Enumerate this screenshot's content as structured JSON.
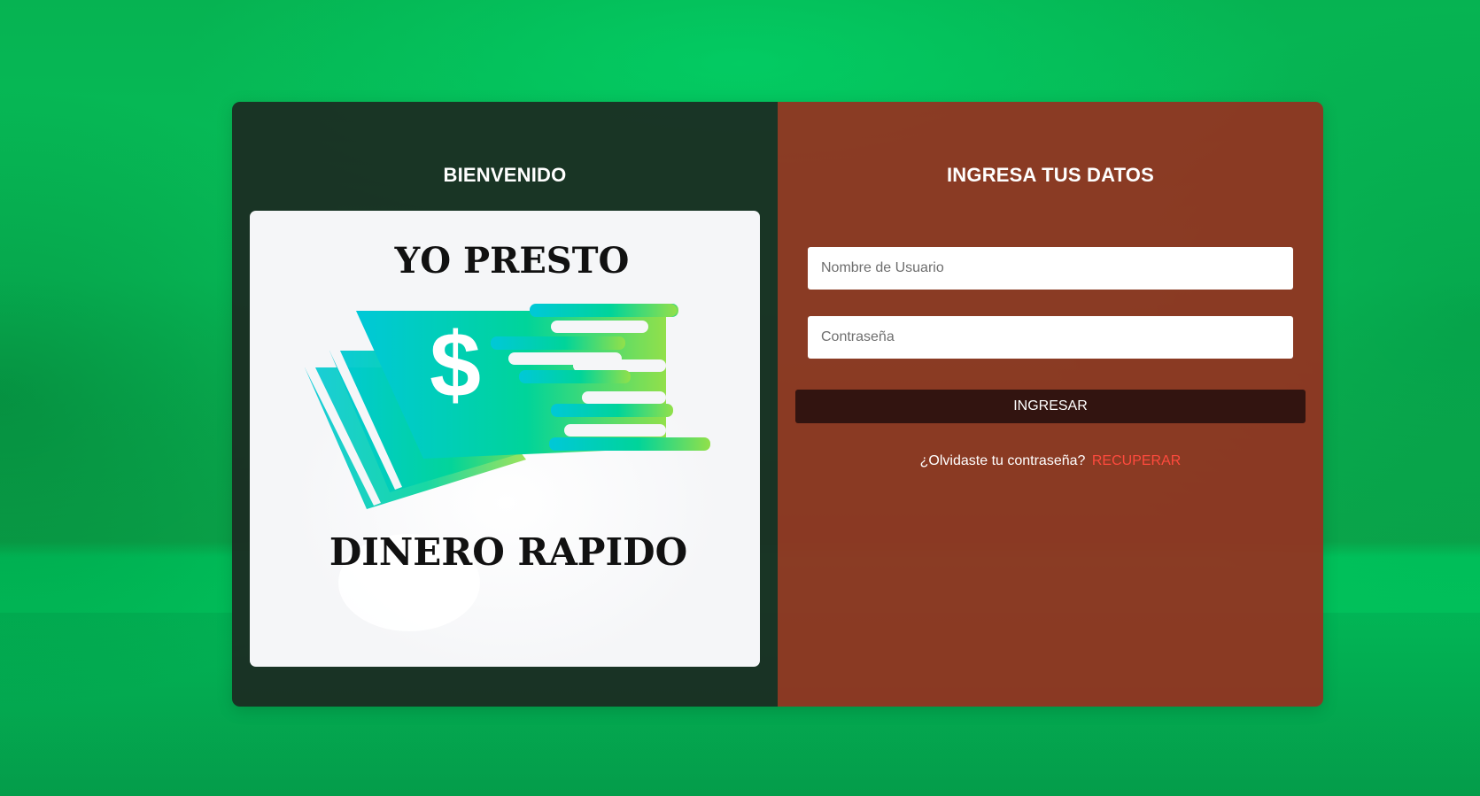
{
  "left_panel": {
    "title": "BIENVENIDO",
    "logo": {
      "top_text": "YO PRESTO",
      "bottom_text": "DINERO RAPIDO",
      "symbol": "$",
      "icon": "money-bills-icon"
    }
  },
  "right_panel": {
    "title": "INGRESA TUS DATOS",
    "username": {
      "placeholder": "Nombre de Usuario",
      "value": ""
    },
    "password": {
      "placeholder": "Contraseña",
      "value": ""
    },
    "submit_label": "INGRESAR",
    "forgot_text": "¿Olvidaste tu contraseña?",
    "recover_link": "RECUPERAR"
  },
  "colors": {
    "background": "#07c05a",
    "left_panel": "#1b2a21",
    "right_panel": "#963020",
    "button": "#321410",
    "link": "#ff4a3d",
    "bill_gradient_start": "#00c8d8",
    "bill_gradient_end": "#92e04a"
  }
}
